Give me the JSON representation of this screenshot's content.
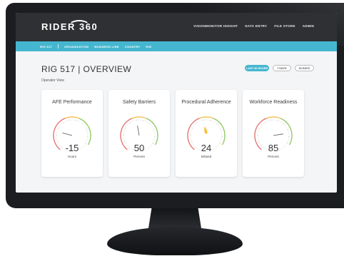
{
  "app": {
    "brand": "RIDER 360",
    "nav": [
      "VISIONMONITOR INSIGHT",
      "DATA ENTRY",
      "FILE STORE",
      "ADMIN"
    ]
  },
  "breadcrumb": [
    "RIG 517",
    "ORGANIZATION",
    "BUSINESS LINE",
    "COUNTRY",
    "RIG"
  ],
  "page": {
    "title": "RIG 517 | OVERVIEW",
    "subtitle": "Operator View"
  },
  "buttons": {
    "primary": "LAST 30 HOURS",
    "b2": "7 DAYS",
    "b3": "30 DAYS"
  },
  "cards": [
    {
      "title": "AFE Performance",
      "value": "-15",
      "unit": "Hours",
      "level": 0.25
    },
    {
      "title": "Safety Barriers",
      "value": "50",
      "unit": "Percent",
      "level": 0.5
    },
    {
      "title": "Procedural Adherence",
      "value": "24",
      "unit": "Missed",
      "level": 0.5
    },
    {
      "title": "Workforce Readiness",
      "value": "85",
      "unit": "Percent",
      "level": 0.85
    }
  ],
  "colors": {
    "topbar": "#2f3033",
    "accent": "#45b6cf",
    "gauge_low": "#e05a5a",
    "gauge_mid": "#f0b429",
    "gauge_high": "#7cc04b",
    "needle_highlight": "#f6c23e"
  }
}
